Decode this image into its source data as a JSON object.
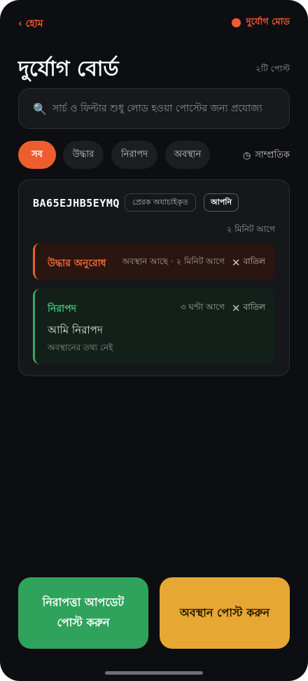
{
  "topbar": {
    "back_label": "‹ হোম",
    "mode_label": "দুর্যোগ মোড",
    "mode_color": "#ee5d2e"
  },
  "header": {
    "title": "দুর্যোগ বোর্ড",
    "post_count": "২টি পোস্ট"
  },
  "search": {
    "icon": "search-icon",
    "placeholder": "সার্চ ও ফিল্টার শুধু লোড হওয়া পোস্টের জন্য প্রযোজ্য"
  },
  "filters": {
    "chips": [
      {
        "label": "সব",
        "active": true
      },
      {
        "label": "উদ্ধার",
        "active": false
      },
      {
        "label": "নিরাপদ",
        "active": false
      },
      {
        "label": "অবস্থান",
        "active": false
      }
    ],
    "sort_icon": "clock-icon",
    "sort_label": "সাম্প্রতিক"
  },
  "card": {
    "device_id": "BA65EJHB5EYMQ",
    "badge_unverified": "প্রেরক অযাচাইকৃত",
    "badge_you": "আপনি",
    "time": "২ মিনিট আগে",
    "entries": [
      {
        "type": "rescue",
        "label": "উদ্ধার অনুরোধ",
        "meta": "অবস্থান আছে · ২ মিনিট আগে",
        "cancel_label": "বাতিল",
        "color": "#ee5d2e"
      },
      {
        "type": "safe",
        "label": "নিরাপদ",
        "meta": "৩ ঘণ্টা আগে",
        "cancel_label": "বাতিল",
        "message": "আমি নিরাপদ",
        "location_note": "অবস্থানের তথ্য নেই",
        "color": "#3aa865"
      }
    ]
  },
  "actions": {
    "safe_update_label": "নিরাপত্তা আপডেট পোস্ট করুন",
    "post_location_label": "অবস্থান পোস্ট করুন",
    "safe_color": "#2fa35c",
    "location_color": "#e6a733"
  }
}
